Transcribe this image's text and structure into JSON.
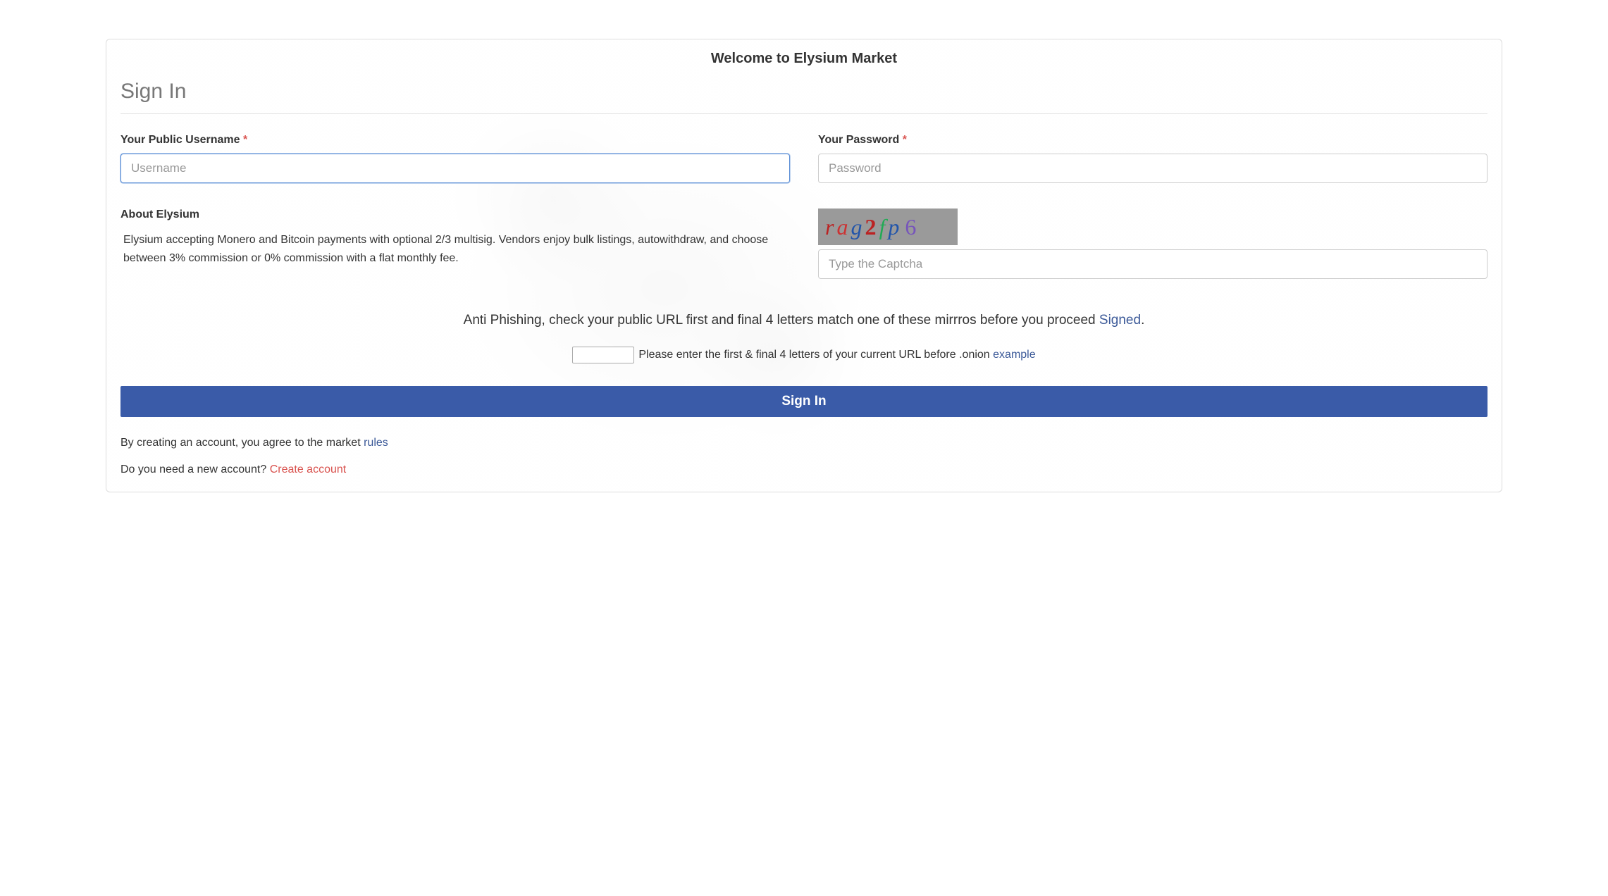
{
  "header": {
    "welcome": "Welcome to Elysium Market",
    "signin_title": "Sign In"
  },
  "form": {
    "username_label": "Your Public Username",
    "required_mark": "*",
    "username_placeholder": "Username",
    "password_label": "Your Password",
    "password_placeholder": "Password",
    "captcha_placeholder": "Type the Captcha",
    "signin_button": "Sign In"
  },
  "about": {
    "heading": "About Elysium",
    "text": "Elysium accepting Monero and Bitcoin payments with optional 2/3 multisig. Vendors enjoy bulk listings, autowithdraw, and choose between 3% commission or 0% commission with a flat monthly fee."
  },
  "captcha": {
    "value": "rag2fp6"
  },
  "antiphish": {
    "text": "Anti Phishing, check your public URL first and final 4 letters match one of these mirrros before you proceed ",
    "signed_link": "Signed",
    "period": ".",
    "url_instruction": "Please enter the first & final 4 letters of your current URL before .onion ",
    "example_link": "example"
  },
  "footer": {
    "agree_text": "By creating an account, you agree to the market ",
    "rules_link": "rules",
    "need_account_text": "Do you need a new account? ",
    "create_link": "Create account"
  }
}
